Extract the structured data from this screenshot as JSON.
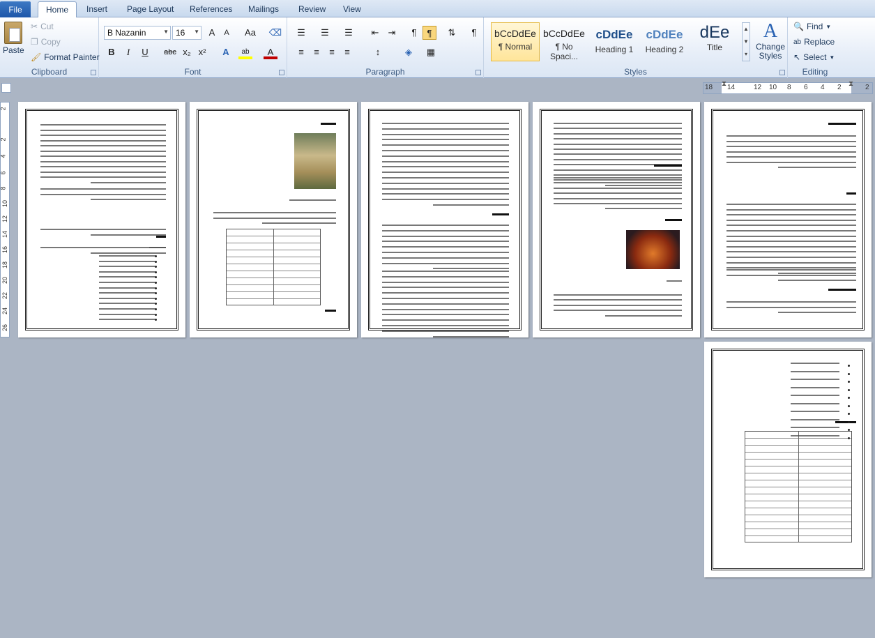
{
  "tabs": [
    "Home",
    "Insert",
    "Page Layout",
    "References",
    "Mailings",
    "Review",
    "View"
  ],
  "file_tab": "File",
  "clipboard": {
    "paste": "Paste",
    "cut": "Cut",
    "copy": "Copy",
    "format_painter": "Format Painter",
    "label": "Clipboard"
  },
  "font": {
    "name": "B Nazanin",
    "size": "16",
    "label": "Font",
    "bold": "B",
    "italic": "I",
    "underline": "U",
    "strike": "abc",
    "sub": "x₂",
    "sup": "x²",
    "grow": "A",
    "shrink": "A",
    "case": "Aa"
  },
  "paragraph": {
    "label": "Paragraph",
    "pilcrow": "¶"
  },
  "styles": {
    "label": "Styles",
    "items": [
      {
        "preview": "bCcDdEe",
        "name": "¶ Normal"
      },
      {
        "preview": "bCcDdEe",
        "name": "¶ No Spaci..."
      },
      {
        "preview": "cDdEe",
        "name": "Heading 1"
      },
      {
        "preview": "cDdEe",
        "name": "Heading 2"
      },
      {
        "preview": "dEe",
        "name": "Title"
      }
    ],
    "change": "Change Styles"
  },
  "editing": {
    "label": "Editing",
    "find": "Find",
    "replace": "Replace",
    "select": "Select"
  },
  "ruler_numbers": [
    "18",
    "14",
    "12",
    "10",
    "8",
    "6",
    "4",
    "2",
    "2"
  ],
  "vruler_numbers": [
    "2",
    "2",
    "4",
    "6",
    "8",
    "10",
    "12",
    "14",
    "16",
    "18",
    "20",
    "22",
    "24",
    "26"
  ],
  "colors": {
    "file_tab": "#2a63b3",
    "page_bg": "#abb5c4",
    "accent_font": "#c00000",
    "highlight": "#ffff00"
  }
}
